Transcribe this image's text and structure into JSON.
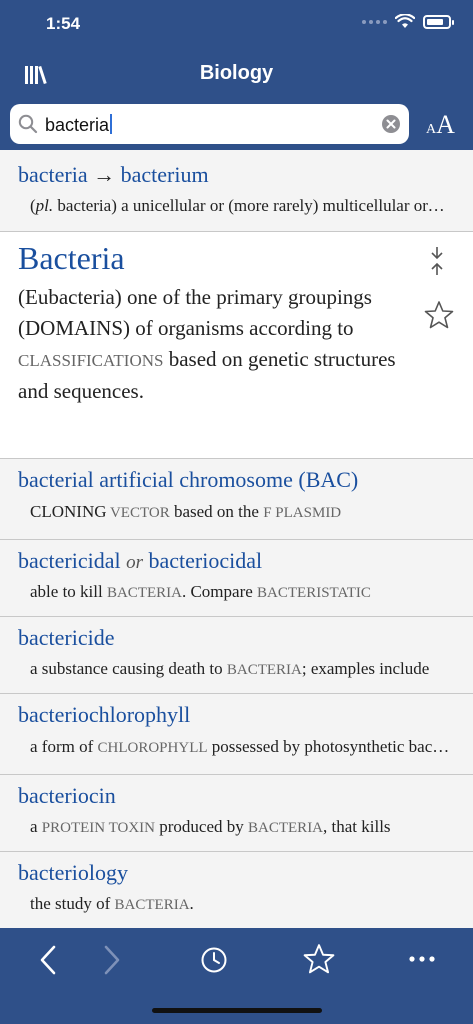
{
  "status": {
    "time": "1:54"
  },
  "nav": {
    "title": "Biology"
  },
  "search": {
    "value": "bacteria"
  },
  "font_size_button": {
    "small": "A",
    "big": "A"
  },
  "colors": {
    "bar": "#2f5089",
    "link": "#1a4f9e"
  },
  "entries": [
    {
      "term_a": "bacteria",
      "arrow": "→",
      "term_b": "bacterium",
      "def_pre": "(",
      "def_pl": "pl.",
      "def_rest": " bacteria) a unicellular or (more rarely) multicellular organism"
    },
    {
      "term": "Bacteria",
      "def_1": "(Eubacteria) one of the primary groupings (DOMAINS) of organisms according to ",
      "def_sc": "CLASSIFICATIONS",
      "def_2": " based on genetic structures and sequences."
    },
    {
      "term": "bacterial artificial chromosome (BAC)",
      "def_a": "CLONING",
      "def_sc1": " VECTOR",
      "def_b": " based on the ",
      "def_sc2": "F PLASMID"
    },
    {
      "term_a": "bactericidal",
      "or": "or",
      "term_b": "bacteriocidal",
      "def_a": "able to kill ",
      "def_sc1": "BACTERIA",
      "def_b": ". Compare ",
      "def_sc2": "BACTERISTATIC"
    },
    {
      "term": "bactericide",
      "def_a": "a substance causing death to ",
      "def_sc1": "BACTERIA",
      "def_b": "; examples include"
    },
    {
      "term": "bacteriochlorophyll",
      "def_a": "a form of ",
      "def_sc1": "CHLOROPHYLL",
      "def_b": " possessed by photosynthetic bacteria"
    },
    {
      "term": "bacteriocin",
      "def_a": "a ",
      "def_sc1": "PROTEIN TOXIN",
      "def_b": " produced by ",
      "def_sc2": "BACTERIA",
      "def_c": ", that kills"
    },
    {
      "term": "bacteriology",
      "def_a": "the study of ",
      "def_sc1": "BACTERIA",
      "def_b": "."
    }
  ],
  "toolbar": {
    "back": "chevron-left-icon",
    "forward": "chevron-right-icon",
    "history": "clock-icon",
    "favorites": "star-icon",
    "more": "more-icon"
  }
}
